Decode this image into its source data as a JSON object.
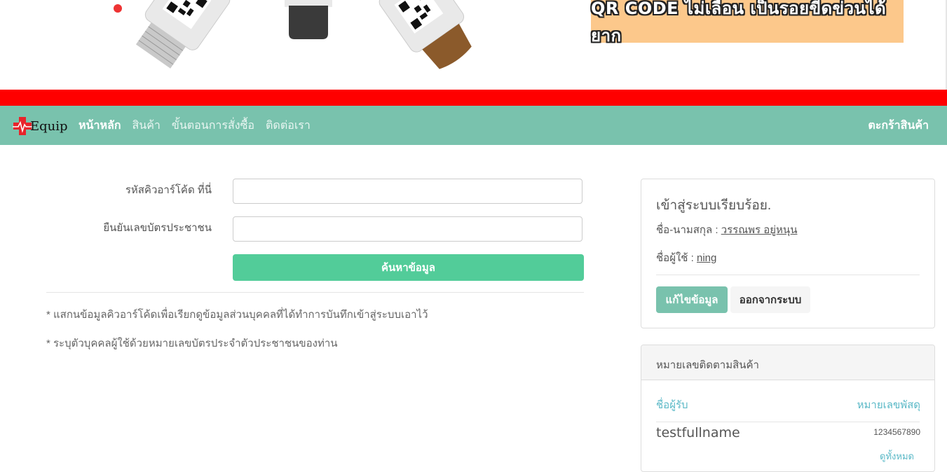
{
  "banner": {
    "tagline": "QR CODE ไม่เลือน เป็นรอยขีดข่วนได้ยาก"
  },
  "navbar": {
    "brand": "Equip",
    "links": [
      "หน้าหลัก",
      "สินค้า",
      "ขั้นตอนการสั่งซื้อ",
      "ติดต่อเรา"
    ],
    "cart": "ตะกร้าสินค้า"
  },
  "form": {
    "qr_label": "รหัสคิวอาร์โค้ด ที่นี่",
    "qr_value": "",
    "id_label": "ยืนยันเลขบัตรประชาชน",
    "id_value": "",
    "search_button": "ค้นหาข้อมูล",
    "notes": [
      "* แสกนข้อมูลคิวอาร์โค้ดเพื่อเรียกดูข้อมูลส่วนบุคคลที่ได้ทำการบันทึกเข้าสู่ระบบเอาไว้",
      "* ระบุตัวบุคคลผู้ใช้ด้วยหมายเลขบัตรประจำตัวประชาชนของท่าน"
    ]
  },
  "login_panel": {
    "title": "เข้าสู่ระบบเรียบร้อย.",
    "name_label": "ชื่อ-นามสกุล :",
    "name_value": "วรรณพร อยู่หนุน",
    "user_label": "ชื่อผู้ใช้ :",
    "user_value": "ning",
    "edit_button": "แก้ไขข้อมูล",
    "logout_button": "ออกจากระบบ"
  },
  "tracking_panel": {
    "heading": "หมายเลขติดตามสินค้า",
    "col_recipient": "ชื่อผู้รับ",
    "col_tracking": "หมายเลขพัสดุ",
    "rows": [
      {
        "recipient": "testfullname",
        "tracking": "1234567890"
      }
    ],
    "view_all": "ดูทั้งหมด"
  },
  "colors": {
    "navbar": "#79c2ad",
    "red_bar": "#ff0000",
    "search_button": "#52cc99",
    "link_teal": "#5bb9c7",
    "banner_orange": "#fcc88b"
  },
  "icons": {
    "brand_logo": "medical-cross-heartbeat-icon"
  }
}
